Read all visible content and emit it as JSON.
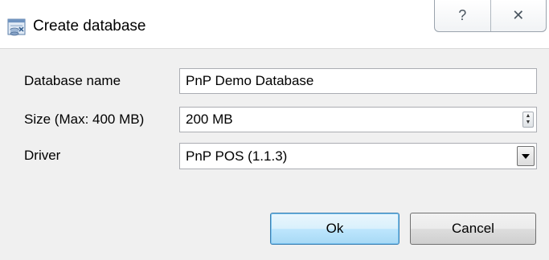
{
  "window": {
    "title": "Create database",
    "help_glyph": "?",
    "close_glyph": "✕"
  },
  "form": {
    "name_label": "Database name",
    "name_value": "PnP Demo Database",
    "size_label": "Size (Max: 400 MB)",
    "size_value": "200 MB",
    "driver_label": "Driver",
    "driver_value": "PnP POS (1.1.3)"
  },
  "buttons": {
    "ok": "Ok",
    "cancel": "Cancel"
  },
  "icons": {
    "app": "database-icon",
    "help": "help-icon",
    "close": "close-icon",
    "spin": "spin-arrows-icon",
    "dropdown": "chevron-down-icon"
  },
  "colors": {
    "dialog_bg": "#f0f0f0",
    "default_button": "#bee6fd"
  }
}
